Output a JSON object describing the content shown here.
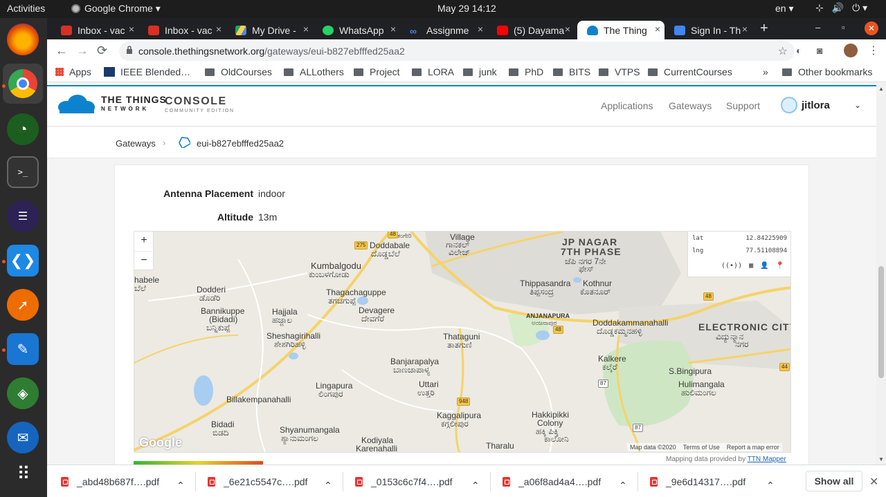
{
  "system": {
    "activities": "Activities",
    "app_name": "Google Chrome ▾",
    "clock": "May 29  14:12",
    "lang": "en ▾",
    "tray": [
      "⊹",
      "🔊",
      "⏻ ▾"
    ]
  },
  "tabs": [
    {
      "label": "Inbox - vac",
      "favicon_color": "#d93025"
    },
    {
      "label": "Inbox - vac",
      "favicon_color": "#d93025"
    },
    {
      "label": "My Drive - ",
      "favicon_color": "#1fa463"
    },
    {
      "label": "WhatsApp",
      "favicon_color": "#25d366"
    },
    {
      "label": "Assignme",
      "favicon_color": "#4285f4"
    },
    {
      "label": "(5) Dayama",
      "favicon_color": "#ff0000"
    },
    {
      "label": "The Thing",
      "favicon_color": "#0d83d0"
    },
    {
      "label": "Sign In - Th",
      "favicon_color": "#4285f4"
    }
  ],
  "tab_close": "×",
  "new_tab": "+",
  "window": {
    "minimize": "–",
    "maximize": "▫",
    "close": "✕"
  },
  "toolbar": {
    "back": "←",
    "forward": "→",
    "reload": "⟳",
    "url_host": "console.thethingsnetwork.org",
    "url_path": "/gateways/eui-b827ebfffed25aa2",
    "star": "☆",
    "menu": "⋮"
  },
  "bookmarks": [
    {
      "label": "Apps",
      "type": "apps"
    },
    {
      "label": "IEEE Blended…",
      "type": "site"
    },
    {
      "label": "OldCourses",
      "type": "folder"
    },
    {
      "label": "ALLothers",
      "type": "folder"
    },
    {
      "label": "Project",
      "type": "folder"
    },
    {
      "label": "LORA",
      "type": "folder"
    },
    {
      "label": "junk",
      "type": "folder"
    },
    {
      "label": "PhD",
      "type": "folder"
    },
    {
      "label": "BITS",
      "type": "folder"
    },
    {
      "label": "VTPS",
      "type": "folder"
    },
    {
      "label": "CurrentCourses",
      "type": "folder"
    }
  ],
  "bookmarks_more": "»",
  "other_bookmarks": "Other bookmarks",
  "ttn": {
    "brand_line1": "THE THINGS",
    "brand_line2": "NETWORK",
    "console": "CONSOLE",
    "edition": "COMMUNITY EDITION",
    "nav": [
      "Applications",
      "Gateways",
      "Support"
    ],
    "username": "jitlora",
    "chevron": "⌄",
    "accent": "#0d83d0"
  },
  "breadcrumb": {
    "root": "Gateways",
    "separator": "›",
    "current": "eui-b827ebfffed25aa2"
  },
  "fields": [
    {
      "label": "Antenna Placement",
      "value": "indoor"
    },
    {
      "label": "Altitude",
      "value": "13m"
    }
  ],
  "map": {
    "zoom_in": "+",
    "zoom_out": "−",
    "lat_label": "lat",
    "lat_value": "12.84225909",
    "lng_label": "lng",
    "lng_value": "77.51108894",
    "tool_icons": [
      "((•))",
      "▦",
      "👤",
      "📍"
    ],
    "google": "Google",
    "footer": [
      "Map data ©2020",
      "Terms of Use",
      "Report a map error"
    ],
    "labels": {
      "village": "Village",
      "village_kn": "ಗಾನಕಲ್",
      "village_kn2": "ವಿಲೇಜ್",
      "jp_nagar": "JP NAGAR",
      "seventh_phase": "7TH PHASE",
      "jp_nagar_kn": "ಜೆಪಿ ನಗರ 7ನೇ",
      "jp_nagar_kn2": "ಫೇಸ್",
      "doddabale": "Doddabale",
      "doddabale_kn": "ದೊಡ್ಡಬೆಲೆ",
      "kumbalgodu": "Kumbalgodu",
      "kumbalgodu_kn": "ಕುಂಬಳಗೋಡು",
      "habele": "habele",
      "habele_kn": "ಬೆಲೆ",
      "dodderi": "Dodderi",
      "dodderi_kn": "ಡೊಡೆರಿ",
      "thagachaguppe": "Thagachaguppe",
      "thagachaguppe_kn": "ತಗಚಗುಪ್ಪೆ",
      "thippasandra": "Thippasandra",
      "thippasandra_kn": "ತಿಪ್ಪಸಂದ್ರ",
      "kothnur": "Kothnur",
      "kothnur_kn": "ಕೊತನೂರ್",
      "bannikuppe": "Bannikuppe",
      "bidadi_paren": "(Bidadi)",
      "bannikuppe_kn": "ಬನ್ನಿಕುಪ್ಪೆ",
      "hajjala": "Hajjala",
      "hajjala_kn": "ಹಜ್ಜಾಲ",
      "devagere": "Devagere",
      "devagere_kn": "ದೇವಗೆರೆ",
      "anjanapura": "ANJANAPURA",
      "anjanapura_kn": "ಅಂಜನಾಪುರ",
      "doddakammanahalli": "Doddakammanahalli",
      "doddakammanahalli_kn": "ದೊಡ್ಡಕಮ್ಮನಹಳ್ಳಿ",
      "electronic_city": "ELECTRONIC CITY",
      "electronic_city_kn": "ವಿದ್ಯುನ್ಮಾನ",
      "electronic_city_kn2": "ನಗರ",
      "sheshagirihalli": "Sheshagirihalli",
      "sheshagirihalli_kn": "ಶೇಶಗಿರಿಹಳ್ಳಿ",
      "thataguni": "Thataguni",
      "thataguni_kn": "ತಾತಗುಣಿ",
      "banjarapalya": "Banjarapalya",
      "banjarapalya_kn": "ಬಾಣಜಾಪಾಳ್ಯ",
      "kalkere": "Kalkere",
      "kalkere_kn": "ಕಲ್ಕೆರೆ",
      "s_bingipura": "S.Bingipura",
      "uttari": "Uttari",
      "uttari_kn": "ಉತ್ತರಿ",
      "hulimangala": "Hulimangala",
      "hulimangala_kn": "ಹುಲಿಮಂಗಲ",
      "lingapura": "Lingapura",
      "lingapura_kn": "ಲಿಂಗಪುರ",
      "billakempanahalli": "Billakempanahalli",
      "kaggalipura": "Kaggalipura",
      "kaggalipura_kn": "ಕಗ್ಗಲೀಪುರ",
      "hakkipikki": "Hakkipikki",
      "colony": "Colony",
      "hakkipikki_kn": "ಹಕ್ಕಿ ಪಿಕ್ಕಿ",
      "colony_kn": "ಕಾಲೋನಿ",
      "bidadi": "Bidadi",
      "bidadi_kn": "ಬಿಡದಿ",
      "shyanumangala": "Shyanumangala",
      "shyanumangala_kn": "ಶ್ಯಾನುಮಂಗಲ",
      "kodiyala": "Kodiyala",
      "karenahalli": "Karenahalli",
      "tharalu": "Tharalu",
      "top_label": "ಕಂಗೇರಿ"
    },
    "shields": [
      "275",
      "48",
      "48",
      "948",
      "87",
      "87",
      "44",
      "48"
    ]
  },
  "mapping_credit": "Mapping data provided by",
  "mapping_link": "TTN Mapper",
  "downloads": [
    "_abd48b687f….pdf",
    "_6e21c5547c….pdf",
    "_0153c6c7f4….pdf",
    "_a06f8ad4a4….pdf",
    "_9e6d14317….pdf"
  ],
  "download_caret": "⌃",
  "show_all": "Show all",
  "downloads_close": "✕"
}
